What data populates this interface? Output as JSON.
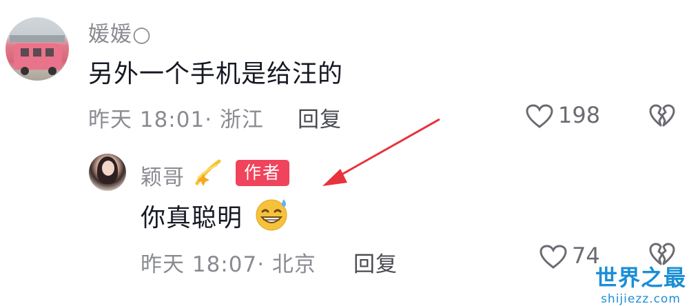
{
  "comments": [
    {
      "username": "媛媛",
      "username_suffix": "○",
      "text": "另外一个手机是给汪的",
      "time_location": "昨天 18:01· 浙江",
      "reply_label": "回复",
      "likes": "198"
    }
  ],
  "reply": {
    "username": "颖哥",
    "author_badge": "作者",
    "text": "你真聪明",
    "time_location": "昨天 18:07· 北京",
    "reply_label": "回复",
    "likes": "74"
  },
  "watermark": {
    "title": "世界之最",
    "url": "shijiezz.com"
  },
  "colors": {
    "arrow": "#e8323c",
    "badge": "#f0435c",
    "watermark": "#1b8ed6"
  },
  "icons": [
    "heart-icon",
    "dislike-broken-heart-icon",
    "sparkle-emoji-icon",
    "grin-sweat-emoji-icon"
  ]
}
